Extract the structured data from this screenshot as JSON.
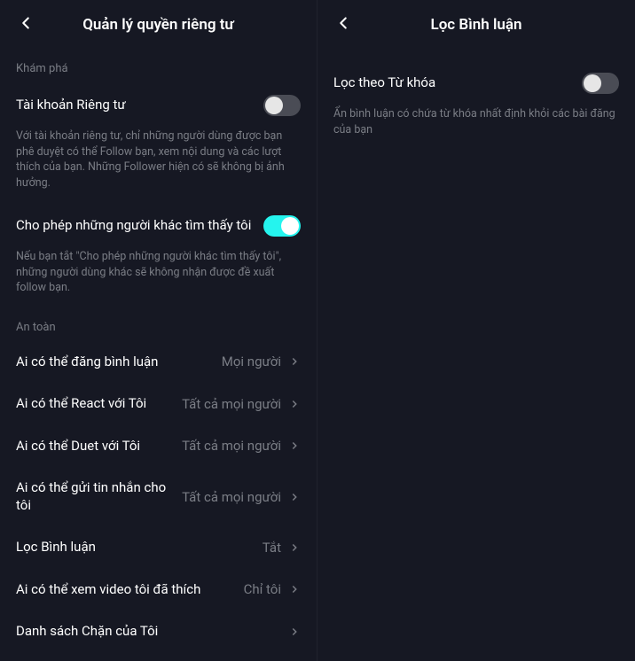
{
  "left": {
    "title": "Quản lý quyền riêng tư",
    "section_discover": "Khám phá",
    "private_account": {
      "label": "Tài khoản Riêng tư",
      "desc": "Với tài khoản riêng tư, chỉ những người dùng được bạn phê duyệt có thể Follow bạn, xem nội dung và các lượt thích của bạn. Những Follower hiện có sẽ không bị ảnh hưởng.",
      "on": false
    },
    "discoverable": {
      "label": "Cho phép những người khác tìm thấy tôi",
      "desc": "Nếu bạn tắt \"Cho phép những người khác tìm thấy tôi\", những người dùng khác sẽ không nhận được đề xuất follow bạn.",
      "on": true
    },
    "section_safety": "An toàn",
    "items": [
      {
        "label": "Ai có thể đăng bình luận",
        "value": "Mọi người"
      },
      {
        "label": "Ai có thể React với Tôi",
        "value": "Tất cả mọi người"
      },
      {
        "label": "Ai có thể Duet với Tôi",
        "value": "Tất cả mọi người"
      },
      {
        "label": "Ai có thể gửi tin nhắn cho tôi",
        "value": "Tất cả mọi người"
      },
      {
        "label": "Lọc Bình luận",
        "value": "Tắt"
      },
      {
        "label": "Ai có thể xem video tôi đã thích",
        "value": "Chỉ tôi"
      },
      {
        "label": "Danh sách Chặn của Tôi",
        "value": ""
      }
    ]
  },
  "right": {
    "title": "Lọc Bình luận",
    "keyword_filter": {
      "label": "Lọc theo Từ khóa",
      "desc": "Ẩn bình luận có chứa từ khóa nhất định khỏi các bài đăng của bạn",
      "on": false
    }
  }
}
